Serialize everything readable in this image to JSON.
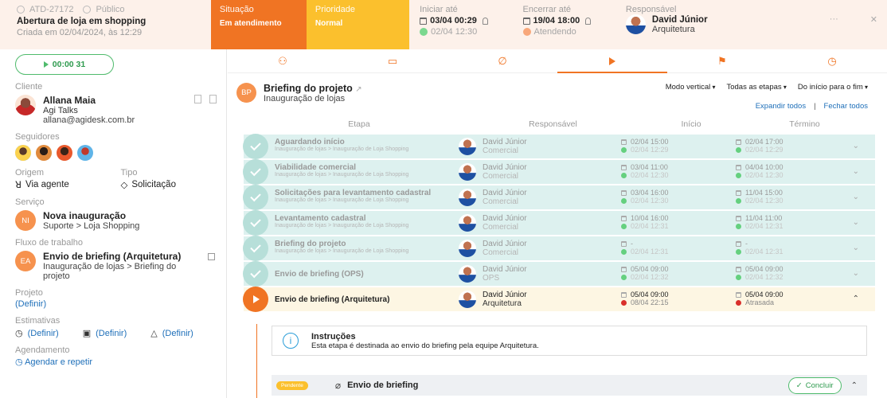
{
  "ticket": {
    "id": "ATD-27172",
    "visibility": "Público",
    "title": "Abertura de loja em shopping",
    "created": "Criada em 02/04/2024, às 12:29"
  },
  "status": {
    "label": "Situação",
    "value": "Em atendimento",
    "color": "#f07423"
  },
  "priority": {
    "label": "Prioridade",
    "value": "Normal",
    "color": "#fbc02d"
  },
  "start": {
    "label": "Iniciar até",
    "date": "03/04 00:29",
    "actual": "02/04 12:30"
  },
  "end": {
    "label": "Encerrar até",
    "date": "19/04 18:00",
    "state": "Atendendo"
  },
  "responsible": {
    "label": "Responsável",
    "name": "David Júnior",
    "team": "Arquitetura"
  },
  "header_actions": {
    "more": "···",
    "close": "✕"
  },
  "timer": {
    "value": "00:00 31"
  },
  "client": {
    "label": "Cliente",
    "name": "Allana Maia",
    "company": "Agi Talks",
    "email": "allana@agidesk.com.br"
  },
  "followers": {
    "label": "Seguidores"
  },
  "origin": {
    "label": "Origem",
    "value": "Via agente"
  },
  "type": {
    "label": "Tipo",
    "value": "Solicitação"
  },
  "service": {
    "label": "Serviço",
    "initials": "NI",
    "title": "Nova inauguração",
    "path": "Suporte > Loja Shopping"
  },
  "workflow": {
    "label": "Fluxo de trabalho",
    "initials": "EA",
    "title": "Envio de briefing (Arquitetura)",
    "path": "Inauguração de lojas > Briefing do projeto"
  },
  "project": {
    "label": "Projeto",
    "value": "(Definir)"
  },
  "estimates": {
    "label": "Estimativas",
    "a": "(Definir)",
    "b": "(Definir)",
    "c": "(Definir)"
  },
  "schedule": {
    "label": "Agendamento",
    "value": "Agendar e repetir"
  },
  "flow": {
    "initials": "BP",
    "title": "Briefing do projeto",
    "subtitle": "Inauguração de lojas",
    "mode": "Modo vertical",
    "filter": "Todas as etapas",
    "order": "Do início para o fim",
    "expand": "Expandir todos",
    "sep": "|",
    "collapse": "Fechar todos"
  },
  "columns": {
    "etapa": "Etapa",
    "resp": "Responsável",
    "inicio": "Início",
    "termino": "Término"
  },
  "steps": [
    {
      "title": "Aguardando início",
      "path": "Inauguração de lojas > Inauguração de Loja Shopping",
      "resp": "David Júnior",
      "team": "Comercial",
      "ini1": "02/04 15:00",
      "ini2": "02/04 12:29",
      "fim1": "02/04 17:00",
      "fim2": "02/04 12:29"
    },
    {
      "title": "Viabilidade comercial",
      "path": "Inauguração de lojas > Inauguração de Loja Shopping",
      "resp": "David Júnior",
      "team": "Comercial",
      "ini1": "03/04 11:00",
      "ini2": "02/04 12:30",
      "fim1": "04/04 10:00",
      "fim2": "02/04 12:30"
    },
    {
      "title": "Solicitações para levantamento cadastral",
      "path": "Inauguração de lojas > Inauguração de Loja Shopping",
      "resp": "David Júnior",
      "team": "Comercial",
      "ini1": "03/04 16:00",
      "ini2": "02/04 12:30",
      "fim1": "11/04 15:00",
      "fim2": "02/04 12:30"
    },
    {
      "title": "Levantamento cadastral",
      "path": "Inauguração de lojas > Inauguração de Loja Shopping",
      "resp": "David Júnior",
      "team": "Comercial",
      "ini1": "10/04 16:00",
      "ini2": "02/04 12:31",
      "fim1": "11/04 11:00",
      "fim2": "02/04 12:31"
    },
    {
      "title": "Briefing do projeto",
      "path": "Inauguração de lojas > Inauguração de Loja Shopping",
      "resp": "David Júnior",
      "team": "Comercial",
      "ini1": "-",
      "ini2": "02/04 12:31",
      "fim1": "-",
      "fim2": "02/04 12:31"
    },
    {
      "title": "Envio de briefing (OPS)",
      "path": "",
      "resp": "David Júnior",
      "team": "OPS",
      "ini1": "05/04 09:00",
      "ini2": "02/04 12:32",
      "fim1": "05/04 09:00",
      "fim2": "02/04 12:32"
    }
  ],
  "current_step": {
    "title": "Envio de briefing (Arquitetura)",
    "resp": "David Júnior",
    "team": "Arquitetura",
    "ini1": "05/04 09:00",
    "ini2": "08/04 22:15",
    "fim1": "05/04 09:00",
    "fim2": "Atrasada"
  },
  "instructions": {
    "title": "Instruções",
    "body": "Esta etapa é destinada ao envio do briefing pela equipe Arquitetura."
  },
  "task": {
    "status": "Pendente",
    "name": "Envio de briefing",
    "action": "Concluir"
  }
}
